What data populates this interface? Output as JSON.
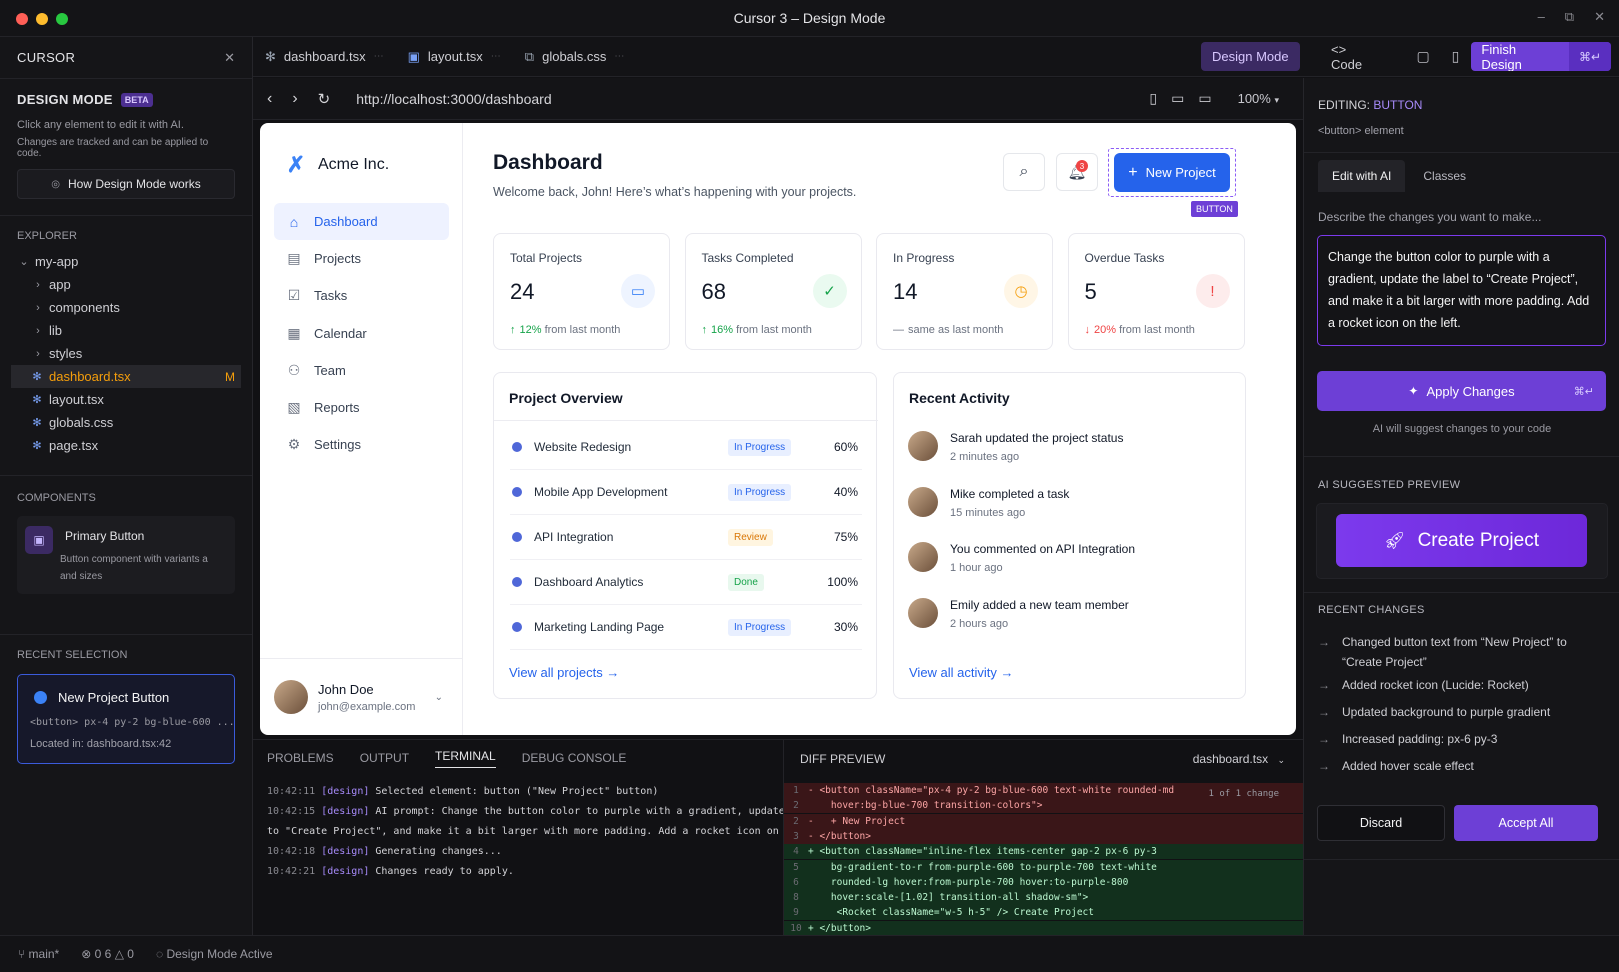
{
  "window": {
    "title": "Cursor 3 – Design Mode"
  },
  "sidebar": {
    "app_name": "CURSOR",
    "mode_title": "DESIGN MODE",
    "beta": "BETA",
    "help1": "Click any element to edit it with AI.",
    "help2": "Changes are tracked and can be applied to code.",
    "how_button": "How Design Mode works",
    "explorer_title": "EXPLORER",
    "tree": [
      {
        "label": "my-app",
        "kind": "folder-open"
      },
      {
        "label": "app",
        "kind": "folder"
      },
      {
        "label": "components",
        "kind": "folder"
      },
      {
        "label": "lib",
        "kind": "folder"
      },
      {
        "label": "styles",
        "kind": "folder"
      },
      {
        "label": "dashboard.tsx",
        "kind": "file",
        "badge": "M"
      },
      {
        "label": "layout.tsx",
        "kind": "file"
      },
      {
        "label": "globals.css",
        "kind": "file"
      },
      {
        "label": "page.tsx",
        "kind": "file"
      }
    ],
    "components_title": "COMPONENTS",
    "component_name": "Primary Button",
    "component_desc1": "Button component with variants a",
    "component_desc2": "and sizes",
    "recent_title": "RECENT SELECTION",
    "recent_name": "New Project Button",
    "recent_code": "<button> px-4 py-2 bg-blue-600 ...",
    "recent_loc": "Located in: dashboard.tsx:42"
  },
  "tabs": [
    "dashboard.tsx",
    "layout.tsx",
    "globals.css"
  ],
  "toolbar": {
    "design_mode": "Design Mode",
    "code": "<> Code",
    "finish": "Finish Design",
    "finish_kbd": "⌘↵"
  },
  "address": {
    "url": "http://localhost:3000/dashboard",
    "zoom": "100%"
  },
  "preview": {
    "brand": "Acme Inc.",
    "nav": [
      "Dashboard",
      "Projects",
      "Tasks",
      "Calendar",
      "Team",
      "Reports",
      "Settings"
    ],
    "user_name": "John Doe",
    "user_email": "john@example.com",
    "page_title": "Dashboard",
    "welcome": "Welcome back, John! Here’s what’s happening with your projects.",
    "notif_count": "3",
    "new_project": "New Project",
    "selection_tag": "BUTTON",
    "stats": [
      {
        "label": "Total Projects",
        "value": "24",
        "change_pct": "12%",
        "change_rest": " from last month",
        "arrow": "↑",
        "color": "#3b82f6",
        "bg": "#eef4ff",
        "icon": "folder-icon",
        "glyph": "▭",
        "pct_color": "#16a34a"
      },
      {
        "label": "Tasks Completed",
        "value": "68",
        "change_pct": "16%",
        "change_rest": " from last month",
        "arrow": "↑",
        "color": "#16a34a",
        "bg": "#eafaf0",
        "icon": "check-circle-icon",
        "glyph": "✓",
        "pct_color": "#16a34a"
      },
      {
        "label": "In Progress",
        "value": "14",
        "change_pct": "",
        "change_rest": "same as last month",
        "arrow": "—",
        "color": "#f59e0b",
        "bg": "#fff6e6",
        "icon": "clock-icon",
        "glyph": "◷",
        "pct_color": "#6b7280"
      },
      {
        "label": "Overdue Tasks",
        "value": "5",
        "change_pct": "20%",
        "change_rest": " from last month",
        "arrow": "↓",
        "color": "#ef4444",
        "bg": "#fdecec",
        "icon": "alert-icon",
        "glyph": "!",
        "pct_color": "#ef4444"
      }
    ],
    "overview_title": "Project Overview",
    "projects": [
      {
        "name": "Website Redesign",
        "status": "In Progress",
        "pct": "60%"
      },
      {
        "name": "Mobile App Development",
        "status": "In Progress",
        "pct": "40%"
      },
      {
        "name": "API Integration",
        "status": "Review",
        "pct": "75%"
      },
      {
        "name": "Dashboard Analytics",
        "status": "Done",
        "pct": "100%"
      },
      {
        "name": "Marketing Landing Page",
        "status": "In Progress",
        "pct": "30%"
      }
    ],
    "view_projects": "View all projects",
    "activity_title": "Recent Activity",
    "activity": [
      {
        "text": "Sarah updated the project status",
        "time": "2 minutes ago"
      },
      {
        "text": "Mike completed a task",
        "time": "15 minutes ago"
      },
      {
        "text": "You commented on API Integration",
        "time": "1 hour ago"
      },
      {
        "text": "Emily added a new team member",
        "time": "2 hours ago"
      }
    ],
    "view_activity": "View all activity"
  },
  "panel": {
    "tabs": [
      "PROBLEMS",
      "OUTPUT",
      "TERMINAL",
      "DEBUG CONSOLE"
    ],
    "terminal": [
      {
        "time": "10:42:11",
        "tag": "[design]",
        "msg": " Selected element: button (\"New Project\" button)"
      },
      {
        "time": "10:42:15",
        "tag": "[design]",
        "msg": " AI prompt: Change the button color to purple with a gradient, update the labe"
      },
      {
        "time": "",
        "tag": "",
        "msg": "to \"Create Project\", and make it a bit larger with more padding. Add a rocket icon on the left."
      },
      {
        "time": "10:42:18",
        "tag": "[design]",
        "msg": " Generating changes..."
      },
      {
        "time": "10:42:21",
        "tag": "[design]",
        "msg": " Changes ready to apply."
      }
    ]
  },
  "diff": {
    "title": "DIFF PREVIEW",
    "file": "dashboard.tsx",
    "count": "1 of 1 change",
    "lines": [
      {
        "n": "1",
        "t": "- <button className=\"px-4 py-2 bg-blue-600 text-white rounded-md",
        "k": "del"
      },
      {
        "n": "2",
        "t": "    hover:bg-blue-700 transition-colors\">",
        "k": "del"
      },
      {
        "n": "2",
        "t": "-   + New Project",
        "k": "del"
      },
      {
        "n": "3",
        "t": "- </button>",
        "k": "del"
      },
      {
        "n": "4",
        "t": "+ <button className=\"inline-flex items-center gap-2 px-6 py-3",
        "k": "add"
      },
      {
        "n": "5",
        "t": "    bg-gradient-to-r from-purple-600 to-purple-700 text-white",
        "k": "add"
      },
      {
        "n": "6",
        "t": "    rounded-lg hover:from-purple-700 hover:to-purple-800",
        "k": "add"
      },
      {
        "n": "8",
        "t": "    hover:scale-[1.02] transition-all shadow-sm\">",
        "k": "add"
      },
      {
        "n": "9",
        "t": "     <Rocket className=\"w-5 h-5\" /> Create Project",
        "k": "add"
      },
      {
        "n": "10",
        "t": "+ </button>",
        "k": "add"
      }
    ]
  },
  "editor": {
    "editing_label": "EDITING:",
    "editing_target": "BUTTON",
    "element": "<button> element",
    "tab_ai": "Edit with AI",
    "tab_classes": "Classes",
    "prompt_hint": "Describe the changes you want to make...",
    "prompt": "Change the button color to purple with a gradient, update the label to “Create Project”, and make it a bit larger with more padding. Add a rocket icon on the left.",
    "apply": "Apply Changes",
    "apply_kbd": "⌘↵",
    "apply_hint": "AI will suggest changes to your code",
    "preview_title": "AI SUGGESTED PREVIEW",
    "preview_button": "Create Project",
    "changes_title": "RECENT CHANGES",
    "changes": [
      "Changed button text from “New Project” to “Create Project”",
      "Added rocket icon (Lucide: Rocket)",
      "Updated background to purple gradient",
      "Increased padding: px-6 py-3",
      "Added hover scale effect"
    ],
    "discard": "Discard",
    "accept": "Accept All"
  },
  "status": {
    "branch": "main*",
    "errors": "0",
    "infos": "6",
    "warnings": "0",
    "mode": "Design Mode Active"
  }
}
